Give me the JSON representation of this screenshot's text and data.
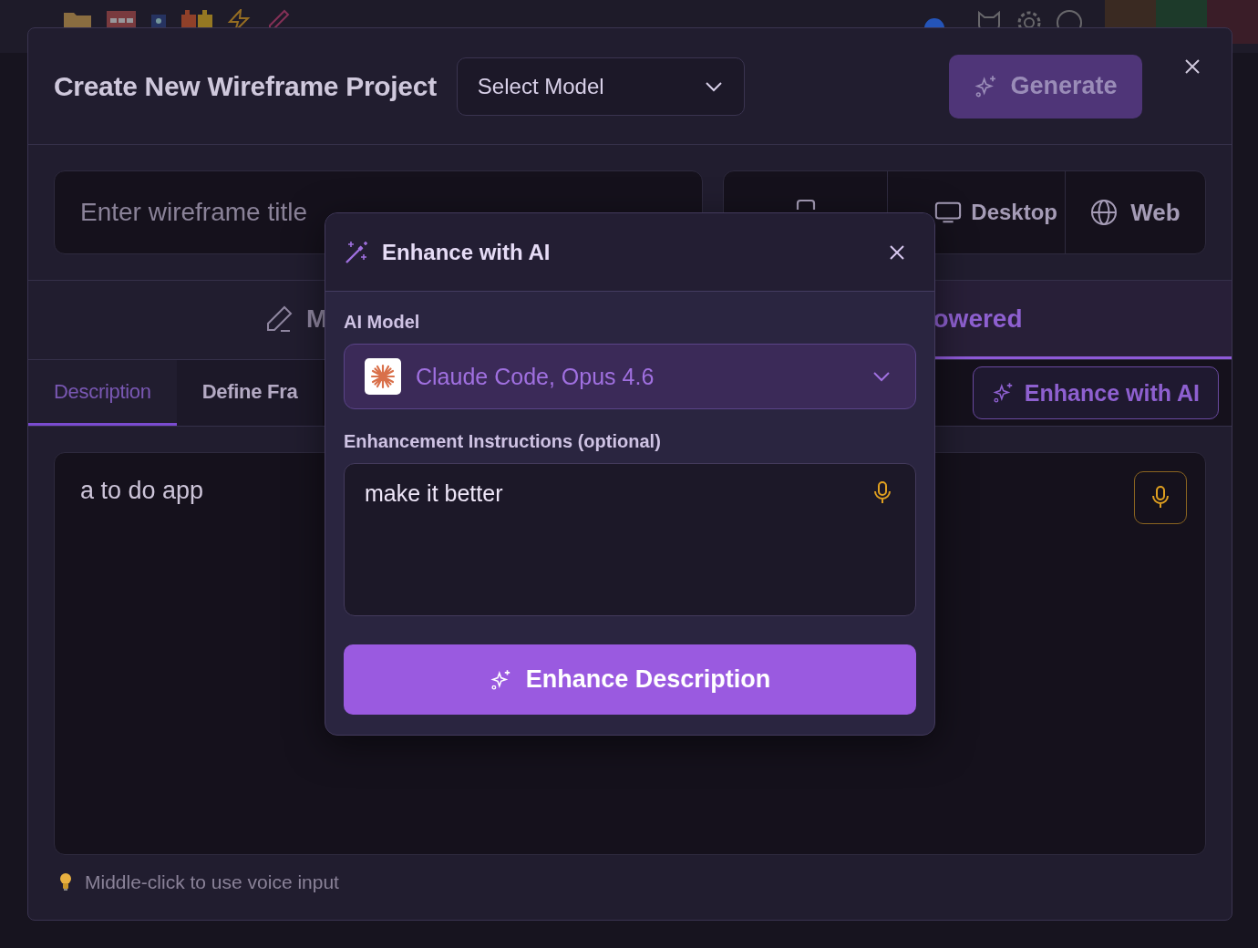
{
  "dialog": {
    "title": "Create New Wireframe Project",
    "model_select": {
      "placeholder": "Select Model"
    },
    "generate_button": {
      "label": "Generate",
      "disabled": true
    }
  },
  "title_field": {
    "placeholder": "Enter wireframe title"
  },
  "platforms": [
    {
      "kind": "mobile",
      "selected": false
    },
    {
      "label": "Desktop",
      "kind": "desktop",
      "selected": false
    },
    {
      "label": "Web",
      "kind": "web",
      "selected": false
    }
  ],
  "modes": [
    {
      "label": "M",
      "kind": "manual",
      "selected": false
    },
    {
      "label": "owered",
      "kind": "ai",
      "selected": true
    }
  ],
  "sections": [
    {
      "label": "Description",
      "selected": true
    },
    {
      "label": "Define Fra",
      "selected": false
    }
  ],
  "enhance_button": "Enhance with AI",
  "description": {
    "value": "a to do app"
  },
  "hint": "Middle-click to use voice input",
  "enhance_popup": {
    "title": "Enhance with AI",
    "model_label": "AI Model",
    "model": "Claude Code, Opus 4.6",
    "instructions_label": "Enhancement Instructions (optional)",
    "instructions": "make it better",
    "submit": "Enhance Description"
  }
}
